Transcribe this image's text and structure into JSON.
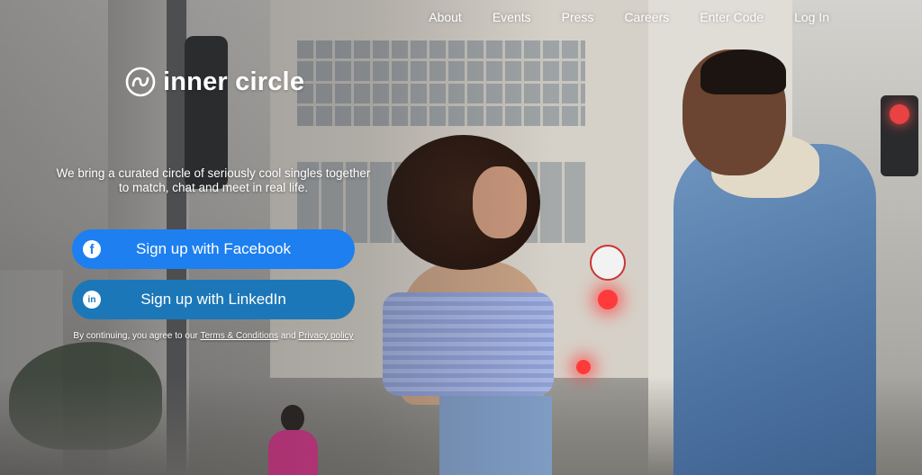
{
  "nav": {
    "items": [
      "About",
      "Events",
      "Press",
      "Careers",
      "Enter Code",
      "Log In"
    ]
  },
  "brand": {
    "name": "inner circle",
    "logo_icon": "interlocking-rings-icon"
  },
  "hero": {
    "tagline": "We bring a curated circle of seriously cool singles together to match, chat and meet in real life."
  },
  "cta": {
    "facebook_label": "Sign up with Facebook",
    "facebook_icon": "facebook-icon",
    "facebook_color": "#1d7ff0",
    "linkedin_label": "Sign up with LinkedIn",
    "linkedin_icon": "linkedin-icon",
    "linkedin_color": "#1b77b8"
  },
  "legal": {
    "prefix": "By continuing, you agree to our",
    "terms": "Terms & Conditions",
    "and": "and",
    "privacy": "Privacy policy"
  }
}
